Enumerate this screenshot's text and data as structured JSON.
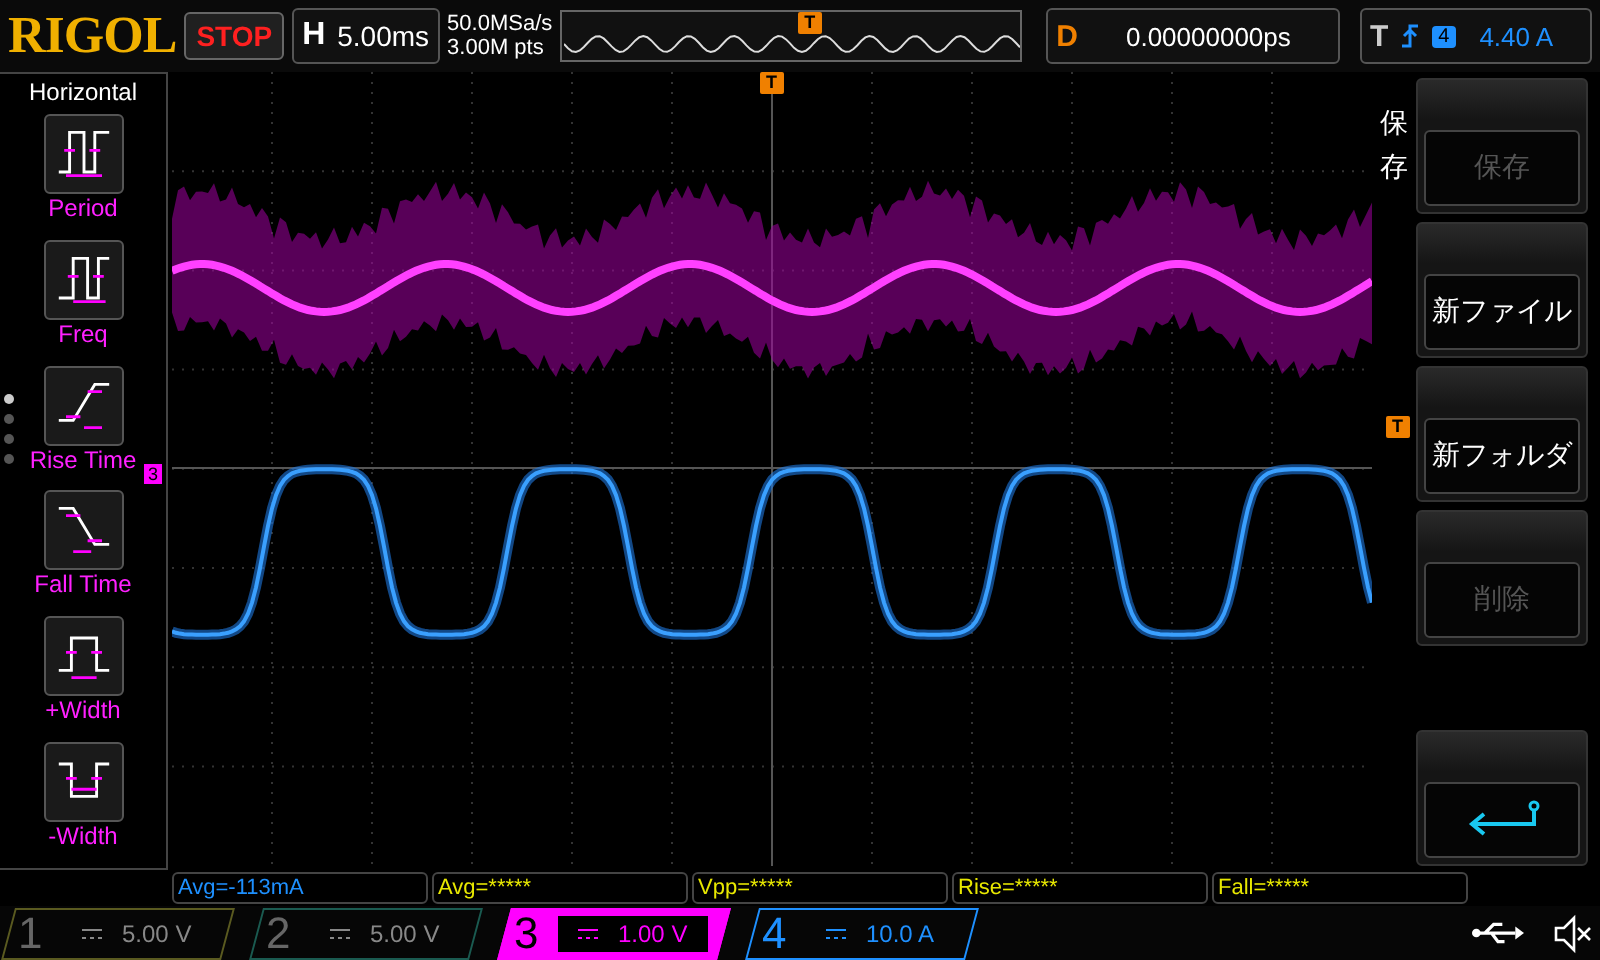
{
  "logo": "RIGOL",
  "run_state": "STOP",
  "timebase": {
    "label": "H",
    "value": "5.00ms"
  },
  "sample_rate": "50.0MSa/s",
  "memory_depth": "3.00M pts",
  "trigger_position_marker": "T",
  "delay": {
    "label": "D",
    "value": "0.00000000ps"
  },
  "trigger": {
    "label": "T",
    "source": "4",
    "level": "4.40 A"
  },
  "left_menu": {
    "title": "Horizontal",
    "items": [
      {
        "label": "Period",
        "kind": "period"
      },
      {
        "label": "Freq",
        "kind": "freq"
      },
      {
        "label": "Rise Time",
        "kind": "rise"
      },
      {
        "label": "Fall Time",
        "kind": "fall"
      },
      {
        "label": "+Width",
        "kind": "pwidth"
      },
      {
        "label": "-Width",
        "kind": "nwidth"
      }
    ],
    "page_dots": [
      {
        "selected": true
      },
      {
        "selected": false
      },
      {
        "selected": false
      },
      {
        "selected": false
      }
    ]
  },
  "plot": {
    "trigger_position_marker": "T",
    "channel_marker": "3",
    "trigger_level_marker": "T"
  },
  "right_menu": {
    "title": "保存",
    "buttons": [
      {
        "label": "保存",
        "disabled": true
      },
      {
        "label": "新ファイル",
        "disabled": false
      },
      {
        "label": "新フォルダ",
        "disabled": false
      },
      {
        "label": "削除",
        "disabled": true
      }
    ]
  },
  "measurements": [
    {
      "text": "Avg=-113mA",
      "color": "#1e90ff"
    },
    {
      "text": "Avg=*****",
      "color": "#e8e800"
    },
    {
      "text": "Vpp=*****",
      "color": "#e8e800"
    },
    {
      "text": "Rise=*****",
      "color": "#e8e800"
    },
    {
      "text": "Fall=*****",
      "color": "#e8e800"
    }
  ],
  "channels": [
    {
      "number": "1",
      "scale": "5.00 V",
      "on": false,
      "selected": false,
      "color": "#5a5a20"
    },
    {
      "number": "2",
      "scale": "5.00 V",
      "on": false,
      "selected": false,
      "color": "#1a5a50"
    },
    {
      "number": "3",
      "scale": "1.00 V",
      "on": true,
      "selected": true,
      "color": "#ff00ff"
    },
    {
      "number": "4",
      "scale": "10.0 A",
      "on": true,
      "selected": false,
      "color": "#1e90ff"
    }
  ]
}
